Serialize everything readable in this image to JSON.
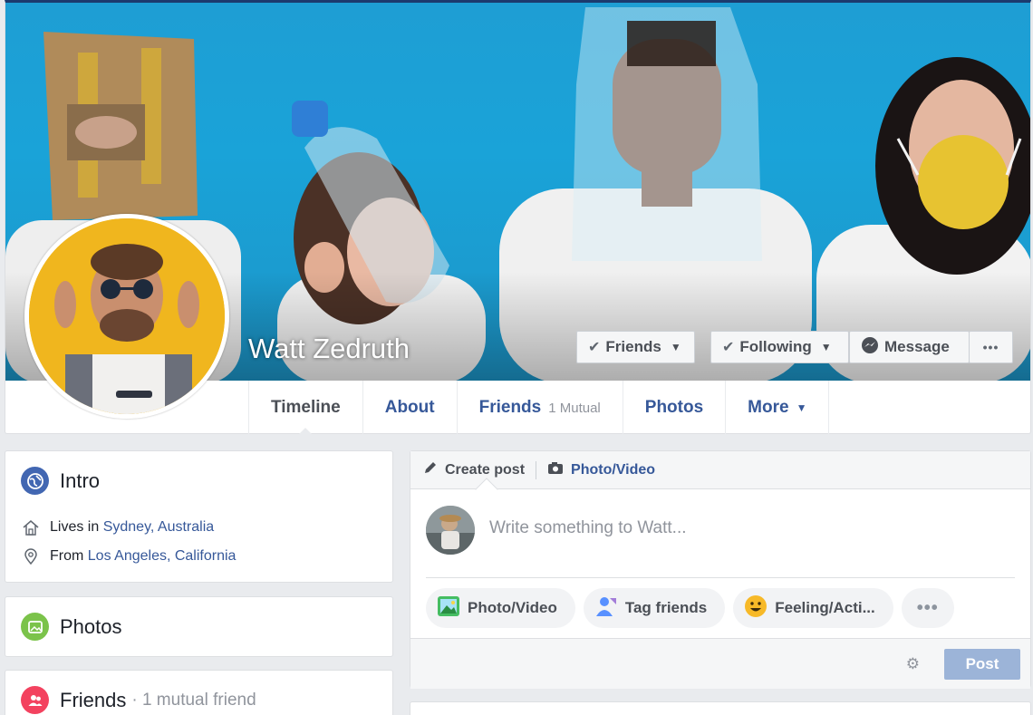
{
  "profile": {
    "name": "Watt Zedruth"
  },
  "actions": {
    "friends": "Friends",
    "following": "Following",
    "message": "Message",
    "more": "•••"
  },
  "tabs": [
    {
      "label": "Timeline"
    },
    {
      "label": "About"
    },
    {
      "label": "Friends",
      "sub": "1 Mutual"
    },
    {
      "label": "Photos"
    },
    {
      "label": "More"
    }
  ],
  "intro": {
    "title": "Intro",
    "lives_prefix": "Lives in",
    "lives_place": "Sydney, Australia",
    "from_prefix": "From",
    "from_place": "Los Angeles, California"
  },
  "photos": {
    "title": "Photos"
  },
  "friends": {
    "title": "Friends",
    "sub": "· 1 mutual friend"
  },
  "composer": {
    "create_post": "Create post",
    "photo_video_tab": "Photo/Video",
    "placeholder": "Write something to Watt...",
    "pills": [
      "Photo/Video",
      "Tag friends",
      "Feeling/Acti..."
    ],
    "more": "•••",
    "post_button": "Post"
  },
  "colors": {
    "brand_link": "#365899",
    "cover_blue": "#1aa3d8",
    "post_disabled": "#9cb4d8",
    "avatar_yellow": "#f0b61e"
  },
  "icons": [
    "globe-icon",
    "home-icon",
    "location-pin-icon",
    "photos-icon",
    "friends-icon",
    "pencil-icon",
    "camera-icon",
    "messenger-icon",
    "gear-icon",
    "checkmark-icon"
  ]
}
